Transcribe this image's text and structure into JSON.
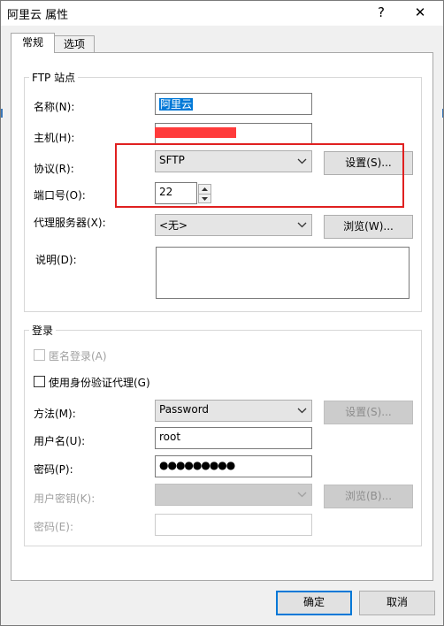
{
  "window": {
    "title": "阿里云 属性",
    "help_label": "?",
    "close_label": "✕"
  },
  "tabs": [
    {
      "label": "常规",
      "active": true
    },
    {
      "label": "选项",
      "active": false
    }
  ],
  "ftp_site": {
    "group_title": "FTP 站点",
    "name_label": "名称(N):",
    "name_value": "阿里云",
    "host_label": "主机(H):",
    "host_value": "",
    "protocol_label": "协议(R):",
    "protocol_value": "SFTP",
    "settings_button": "设置(S)...",
    "port_label": "端口号(O):",
    "port_value": "22",
    "proxy_label": "代理服务器(X):",
    "proxy_value": "<无>",
    "browse_button": "浏览(W)...",
    "description_label": "说明(D):",
    "description_value": ""
  },
  "login": {
    "group_title": "登录",
    "anonymous_label": "匿名登录(A)",
    "anonymous_checked": false,
    "agent_label": "使用身份验证代理(G)",
    "agent_checked": false,
    "method_label": "方法(M):",
    "method_value": "Password",
    "method_settings_button": "设置(S)...",
    "username_label": "用户名(U):",
    "username_value": "root",
    "password_label": "密码(P):",
    "password_value": "●●●●●●●●●",
    "user_key_label": "用户密钥(K):",
    "user_key_value": "",
    "key_browse_button": "浏览(B)...",
    "passphrase_label": "密码(E):",
    "passphrase_value": ""
  },
  "footer": {
    "ok_button": "确定",
    "cancel_button": "取消"
  },
  "colors": {
    "accent": "#0078d7",
    "annotation": "#e02020",
    "redaction": "#ff3b3b"
  }
}
